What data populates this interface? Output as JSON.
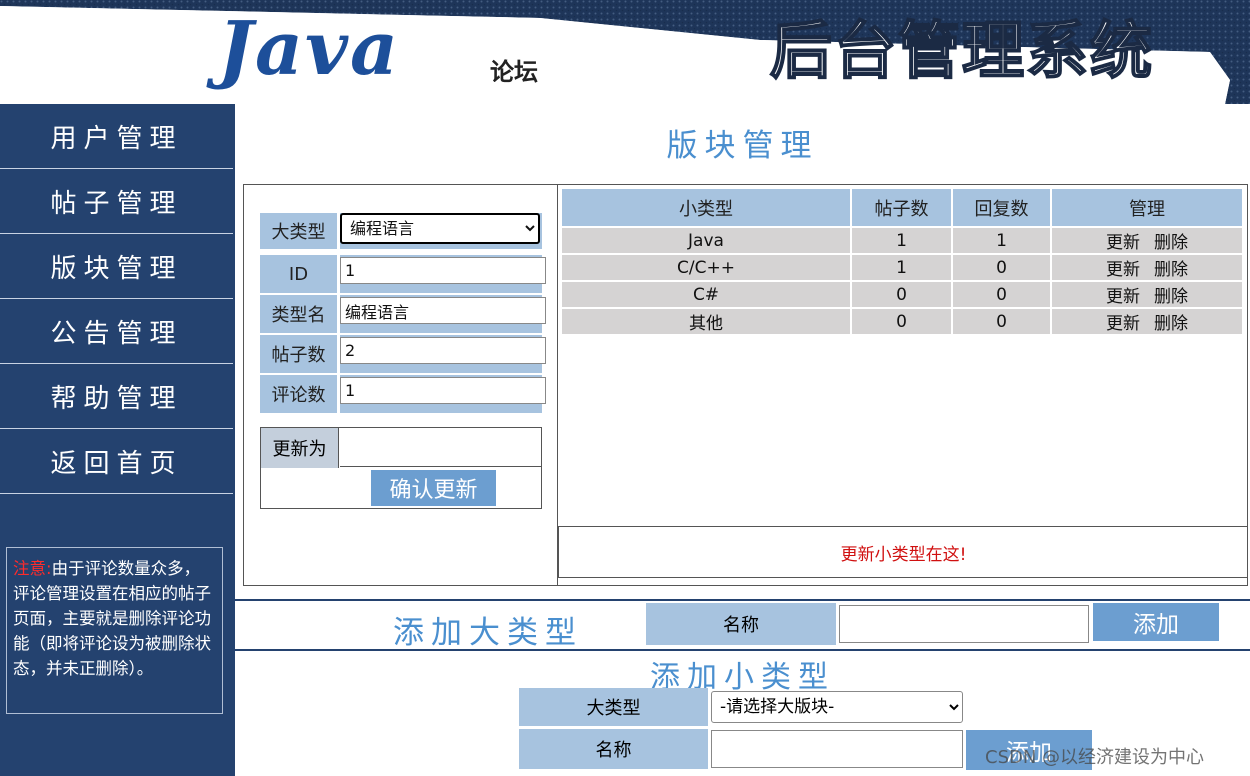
{
  "header": {
    "logo_text": "Java",
    "logo_sub": "论坛",
    "banner_title": "后台管理系统"
  },
  "sidebar": {
    "items": [
      {
        "label": "用户管理"
      },
      {
        "label": "帖子管理"
      },
      {
        "label": "版块管理"
      },
      {
        "label": "公告管理"
      },
      {
        "label": "帮助管理"
      },
      {
        "label": "返回首页"
      }
    ],
    "notice_prefix": "注意:",
    "notice_text": "由于评论数量众多，评论管理设置在相应的帖子页面，主要就是删除评论功能（即将评论设为被删除状态，并未正删除）。"
  },
  "main": {
    "title": "版块管理",
    "form": {
      "big_type_label": "大类型",
      "big_type_value": "编程语言",
      "id_label": "ID",
      "id_value": "1",
      "type_name_label": "类型名",
      "type_name_value": "编程语言",
      "post_count_label": "帖子数",
      "post_count_value": "2",
      "comment_count_label": "评论数",
      "comment_count_value": "1",
      "update_label": "更新为",
      "confirm_label": "确认更新"
    },
    "table": {
      "headers": [
        "小类型",
        "帖子数",
        "回复数",
        "管理"
      ],
      "rows": [
        {
          "name": "Java",
          "posts": "1",
          "replies": "1"
        },
        {
          "name": "C/C++",
          "posts": "1",
          "replies": "0"
        },
        {
          "name": "C#",
          "posts": "0",
          "replies": "0"
        },
        {
          "name": "其他",
          "posts": "0",
          "replies": "0"
        }
      ],
      "update_link": "更新",
      "delete_link": "删除"
    },
    "sub_update_hint": "更新小类型在这!",
    "add_big": {
      "title": "添加大类型",
      "name_label": "名称",
      "button": "添加"
    },
    "add_small": {
      "title": "添加小类型",
      "type_label": "大类型",
      "type_placeholder": "-请选择大版块-",
      "name_label": "名称",
      "button": "添加"
    }
  },
  "watermark": "CSDN @以经济建设为中心",
  "colors": {
    "sidebar_bg": "#24426f",
    "accent_blue": "#4a8fcf",
    "label_bg": "#a7c3df",
    "button_bg": "#6c9ed0",
    "row_bg": "#d5d3d3",
    "hint_red": "#d01010"
  }
}
